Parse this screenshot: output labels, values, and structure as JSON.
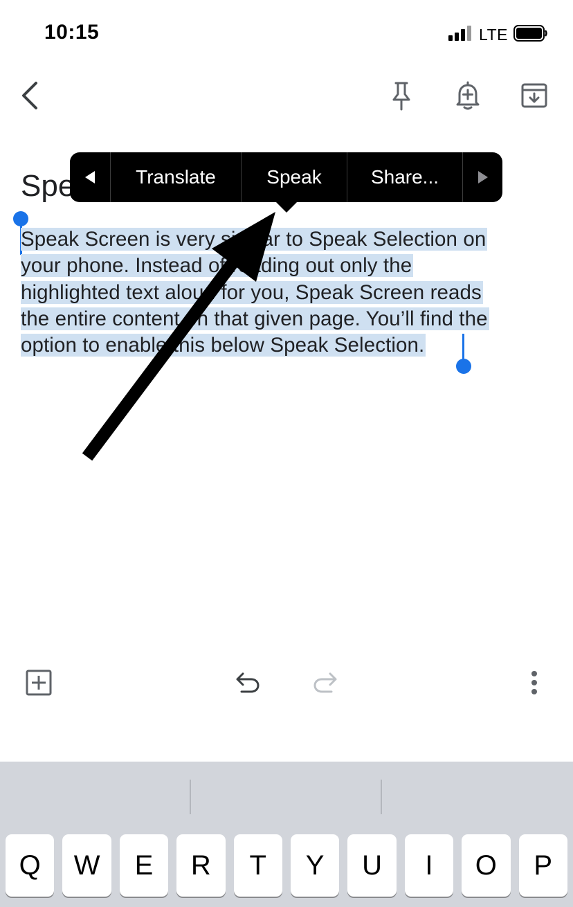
{
  "status_bar": {
    "time": "10:15",
    "carrier": "LTE",
    "icons": [
      "signal-icon",
      "battery-icon"
    ]
  },
  "toolbar": {
    "icons": [
      "back-icon",
      "pin-icon",
      "reminder-bell-icon",
      "archive-icon"
    ]
  },
  "note": {
    "title_visible": "Spe",
    "body_lines": [
      "Speak Screen is very similar to Speak Selection on",
      "your phone. Instead of reading out only the",
      "highlighted text aloud for you, Speak Screen reads",
      "the entire content on that given page. You’ll find the",
      "option to enable this below Speak Selection."
    ]
  },
  "edit_menu": {
    "prev_icon": "chevron-left-icon",
    "items": [
      {
        "label": "Translate"
      },
      {
        "label": "Speak"
      },
      {
        "label": "Share..."
      }
    ],
    "next_icon": "chevron-right-icon"
  },
  "bottom_toolbar": {
    "icons": [
      "add-box-icon",
      "undo-icon",
      "redo-icon",
      "more-vert-icon"
    ]
  },
  "keyboard": {
    "keys": [
      "Q",
      "W",
      "E",
      "R",
      "T",
      "Y",
      "U",
      "I",
      "O",
      "P"
    ]
  },
  "colors": {
    "selection": "#cfe0f1",
    "selection_handle": "#1a73e8",
    "menu_background": "#000000",
    "keyboard_background": "#d2d5db",
    "annotation_arrow": "#000000"
  }
}
